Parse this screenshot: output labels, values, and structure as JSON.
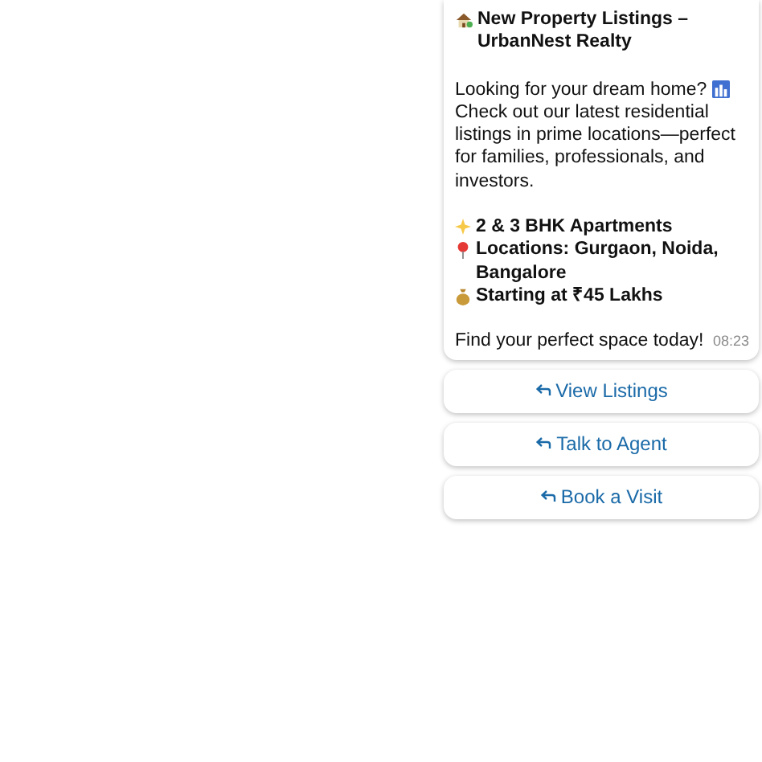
{
  "message": {
    "title": "New Property Listings – UrbanNest Realty",
    "intro": "Looking for your dream home?",
    "intro_rest": "Check out our latest residential listings in prime locations—perfect for families, professionals, and investors.",
    "highlights": [
      {
        "kind": "sparkle",
        "text": "2 & 3 BHK Apartments"
      },
      {
        "kind": "pin",
        "text": "Locations: Gurgaon, Noida, Bangalore"
      },
      {
        "kind": "money",
        "text": "Starting at ₹45 Lakhs"
      }
    ],
    "closing": "Find your perfect space today!",
    "time": "08:23"
  },
  "buttons": [
    {
      "label": "View Listings"
    },
    {
      "label": "Talk to Agent"
    },
    {
      "label": "Book a Visit"
    }
  ]
}
